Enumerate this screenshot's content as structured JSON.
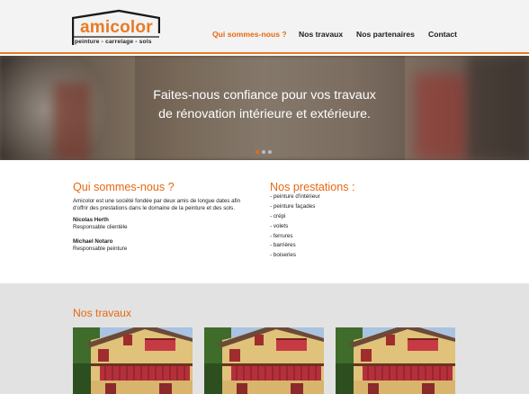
{
  "header": {
    "logo": {
      "name": "amicolor",
      "tagline": "peinture - carrelage - sols"
    },
    "nav": [
      {
        "label": "Qui sommes-nous ?",
        "active": true
      },
      {
        "label": "Nos travaux",
        "active": false
      },
      {
        "label": "Nos partenaires",
        "active": false
      },
      {
        "label": "Contact",
        "active": false
      }
    ]
  },
  "hero": {
    "line1": "Faites-nous confiance pour vos travaux",
    "line2": "de rénovation intérieure et extérieure.",
    "slides_total": 3,
    "active_slide": 1
  },
  "about": {
    "title": "Qui sommes-nous ?",
    "description": "Amicolor est une société fondée par deux amis de longue dates afin d'offrir des prestations dans le domaine de la peinture et des sols.",
    "people": [
      {
        "name": "Nicolas Herth",
        "role": "Responsable clientèle"
      },
      {
        "name": "Michael Notaro",
        "role": "Responsable peinture"
      }
    ]
  },
  "services": {
    "title": "Nos prestations :",
    "items": [
      "- peinture d'intérieur",
      "- peinture façades",
      "- crépi",
      "- volets",
      "- ferrures",
      "- barrières",
      "- boiseries"
    ]
  },
  "works": {
    "title": "Nos travaux",
    "thumbnail_count": 3
  },
  "colors": {
    "accent": "#e8670f",
    "header_bg": "#f3f3f3",
    "works_bg": "#e2e2e2",
    "text": "#222222"
  }
}
